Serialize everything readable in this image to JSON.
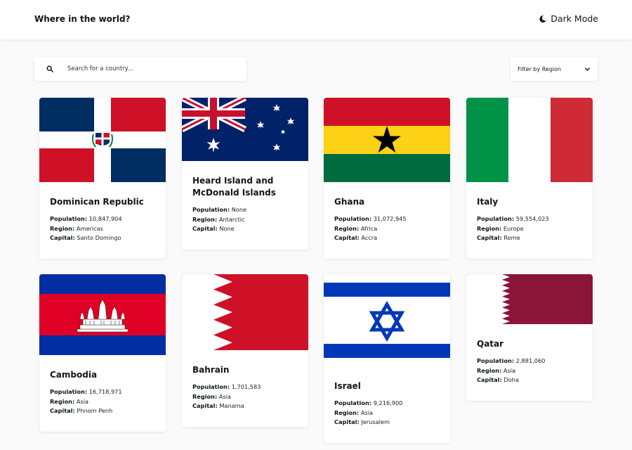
{
  "header": {
    "title": "Where in the world?",
    "dark_mode_label": "Dark Mode"
  },
  "search": {
    "placeholder": "Search for a country...",
    "value": ""
  },
  "filter": {
    "label": "Filter by Region"
  },
  "field_labels": {
    "population": "Population:",
    "region": "Region:",
    "capital": "Capital:"
  },
  "countries": [
    {
      "name": "Dominican Republic",
      "population": "10,847,904",
      "region": "Americas",
      "capital": "Santo Domingo"
    },
    {
      "name": "Heard Island and McDonald Islands",
      "population": "None",
      "region": "Antarctic",
      "capital": "None"
    },
    {
      "name": "Ghana",
      "population": "31,072,945",
      "region": "Africa",
      "capital": "Accra"
    },
    {
      "name": "Italy",
      "population": "59,554,023",
      "region": "Europe",
      "capital": "Rome"
    },
    {
      "name": "Cambodia",
      "population": "16,718,971",
      "region": "Asia",
      "capital": "Phnom Penh"
    },
    {
      "name": "Bahrain",
      "population": "1,701,583",
      "region": "Asia",
      "capital": "Manama"
    },
    {
      "name": "Israel",
      "population": "9,216,900",
      "region": "Asia",
      "capital": "Jerusalem"
    },
    {
      "name": "Qatar",
      "population": "2,881,060",
      "region": "Asia",
      "capital": "Doha"
    }
  ]
}
